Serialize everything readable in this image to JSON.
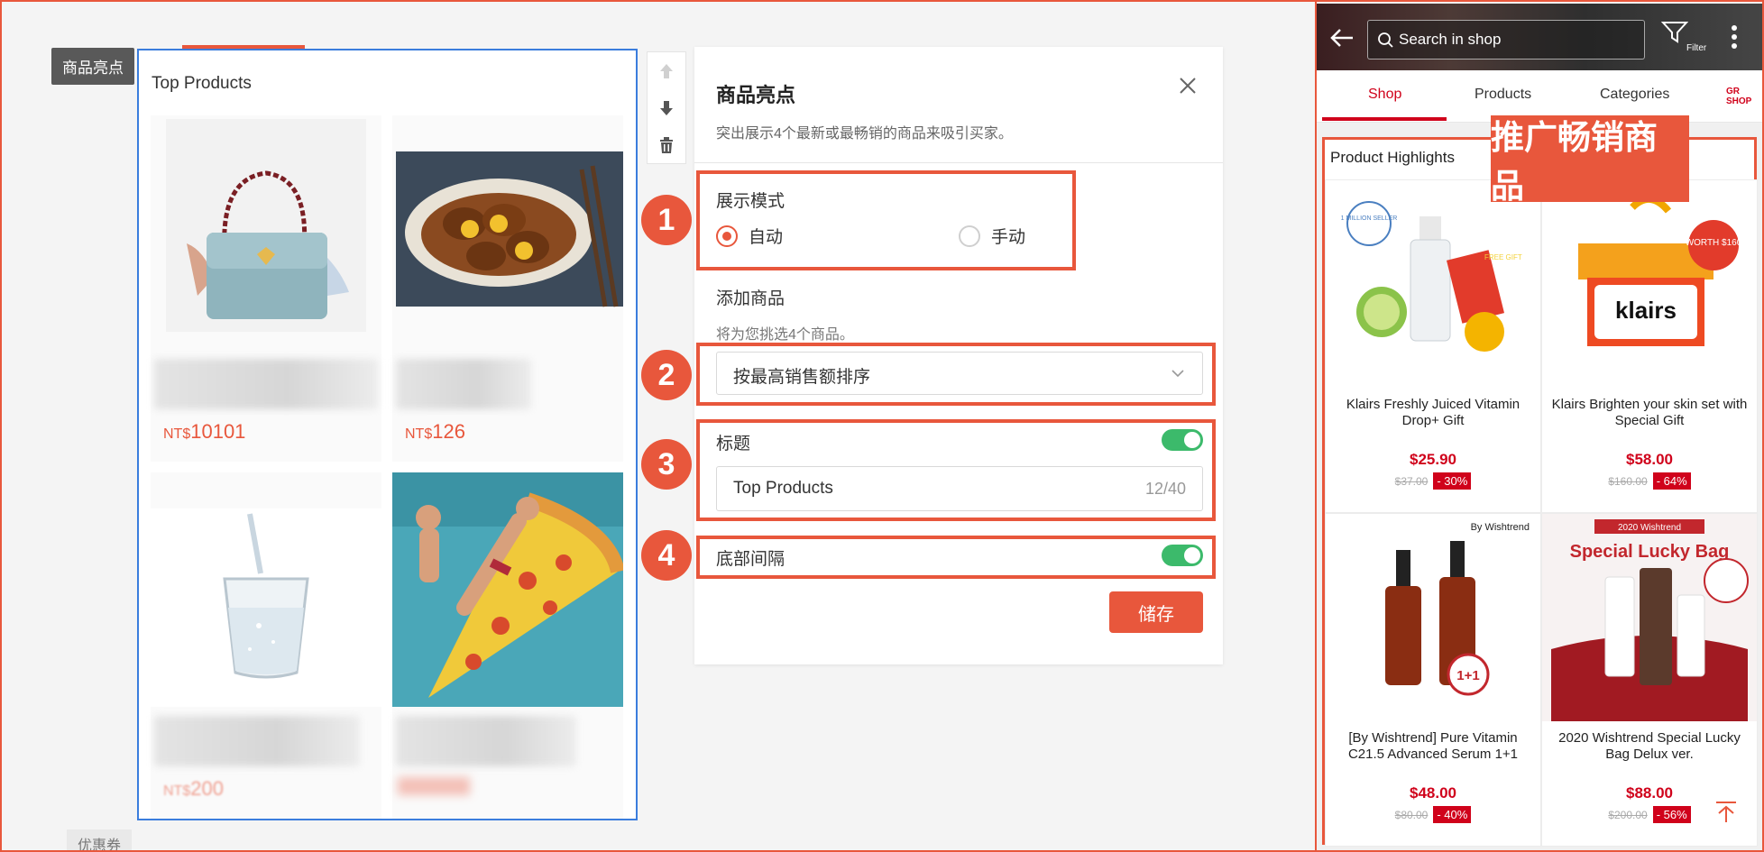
{
  "editor": {
    "section_tag": "商品亮点",
    "section_tag_next": "优惠券",
    "preview_title": "Top Products",
    "cards": [
      {
        "price_prefix": "NT$",
        "price": "10101"
      },
      {
        "price_prefix": "NT$",
        "price": "126"
      },
      {
        "price_prefix": "NT$",
        "price": "200"
      },
      {
        "price_prefix": "",
        "price": ""
      }
    ]
  },
  "panel": {
    "title": "商品亮点",
    "subtitle": "突出展示4个最新或最畅销的商品来吸引买家。",
    "display_mode_label": "展示模式",
    "mode_auto": "自动",
    "mode_manual": "手动",
    "add_products_label": "添加商品",
    "add_products_hint": "将为您挑选4个商品。",
    "sort_select_value": "按最高销售额排序",
    "title_label": "标题",
    "title_value": "Top Products",
    "title_count": "12/40",
    "bottom_spacing_label": "底部间隔",
    "save_label": "储存"
  },
  "annotations": [
    "1",
    "2",
    "3",
    "4"
  ],
  "phone": {
    "search_placeholder": "Search in shop",
    "filter_label": "Filter",
    "tabs": [
      "Shop",
      "Products",
      "Categories",
      "GR SHOP"
    ],
    "section_title": "Product Highlights",
    "promo_label": "推广畅销商品",
    "products": [
      {
        "name": "Klairs Freshly Juiced Vitamin Drop+ Gift",
        "price": "$25.90",
        "old_price": "$37.00",
        "discount": "- 30%",
        "badge": "1 MILLION SELLER",
        "sub_badge": "FREE GIFT"
      },
      {
        "name": "Klairs Brighten your skin set with Special Gift",
        "price": "$58.00",
        "old_price": "$160.00",
        "discount": "- 64%",
        "badge": "WORTH $160",
        "sub_badge": "klairs"
      },
      {
        "name": "[By Wishtrend] Pure Vitamin C21.5 Advanced Serum 1+1",
        "price": "$48.00",
        "old_price": "$80.00",
        "discount": "- 40%",
        "badge": "By Wishtrend",
        "sub_badge": "1+1"
      },
      {
        "name": "2020 Wishtrend Special Lucky Bag Delux ver.",
        "price": "$88.00",
        "old_price": "$200.00",
        "discount": "- 56%",
        "badge": "2020 Wishtrend",
        "sub_badge": "Special Lucky Bag"
      }
    ]
  },
  "colors": {
    "accent": "#e8573c",
    "toggle_on": "#3cba6b",
    "shop_red": "#d0021b",
    "preview_border": "#3b7ddd"
  }
}
